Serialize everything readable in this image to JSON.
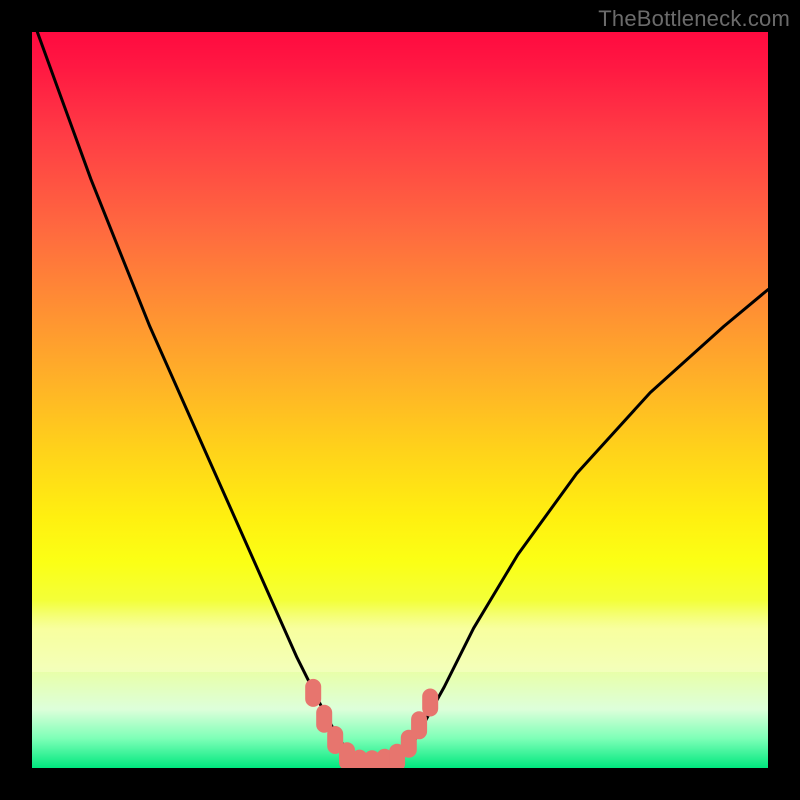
{
  "watermark": {
    "text": "TheBottleneck.com"
  },
  "chart_data": {
    "type": "line",
    "title": "",
    "xlabel": "",
    "ylabel": "",
    "xlim": [
      0,
      100
    ],
    "ylim": [
      0,
      100
    ],
    "grid": false,
    "series": [
      {
        "name": "bottleneck-curve",
        "x": [
          0,
          4,
          8,
          12,
          16,
          20,
          24,
          28,
          32,
          36,
          38.5,
          40,
          42,
          44,
          46,
          47.5,
          49.5,
          52,
          56,
          60,
          66,
          74,
          84,
          94,
          100
        ],
        "y": [
          102,
          91,
          80,
          70,
          60,
          51,
          42,
          33,
          24,
          15,
          10,
          7,
          3.5,
          1.2,
          0.4,
          0.4,
          1.1,
          3.8,
          11,
          19,
          29,
          40,
          51,
          60,
          65
        ],
        "stroke": "#000000",
        "stroke_width": 3
      }
    ],
    "markers": [
      {
        "name": "bottleneck-markers",
        "shape": "rounded-capsule",
        "color": "#e7756e",
        "points": [
          {
            "x": 38.2,
            "y": 10.2
          },
          {
            "x": 39.7,
            "y": 6.7
          },
          {
            "x": 41.2,
            "y": 3.8
          },
          {
            "x": 42.8,
            "y": 1.6
          },
          {
            "x": 44.5,
            "y": 0.6
          },
          {
            "x": 46.2,
            "y": 0.5
          },
          {
            "x": 47.9,
            "y": 0.7
          },
          {
            "x": 49.6,
            "y": 1.4
          },
          {
            "x": 51.2,
            "y": 3.3
          },
          {
            "x": 52.6,
            "y": 5.8
          },
          {
            "x": 54.1,
            "y": 8.9
          }
        ]
      }
    ],
    "background": {
      "type": "vertical-gradient",
      "stops": [
        {
          "pos": 0.0,
          "color": "#ff0a40"
        },
        {
          "pos": 0.36,
          "color": "#ff8a35"
        },
        {
          "pos": 0.66,
          "color": "#fff010"
        },
        {
          "pos": 0.92,
          "color": "#ddffda"
        },
        {
          "pos": 1.0,
          "color": "#00e77e"
        }
      ]
    }
  }
}
